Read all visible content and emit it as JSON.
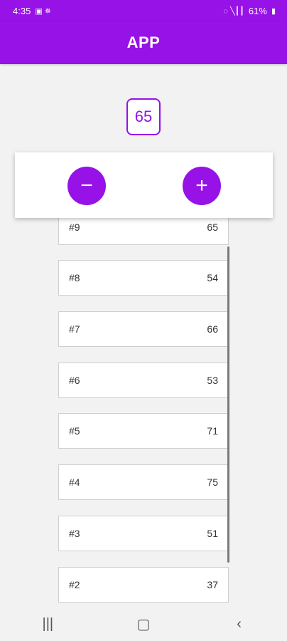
{
  "status_bar": {
    "time": "4:35",
    "battery": "61%",
    "left_icons": "▣ ✵",
    "right_icons": "◌ ╲┃┃"
  },
  "app_bar": {
    "title": "APP",
    "color": "#9612e6"
  },
  "counter": {
    "value": "65"
  },
  "controls": {
    "minus_label": "−",
    "plus_label": "+"
  },
  "list": {
    "items": [
      {
        "label": "#9",
        "value": "65"
      },
      {
        "label": "#8",
        "value": "54"
      },
      {
        "label": "#7",
        "value": "66"
      },
      {
        "label": "#6",
        "value": "53"
      },
      {
        "label": "#5",
        "value": "71"
      },
      {
        "label": "#4",
        "value": "75"
      },
      {
        "label": "#3",
        "value": "51"
      },
      {
        "label": "#2",
        "value": "37"
      }
    ]
  },
  "nav_bar": {
    "recents_icon": "|||",
    "home_icon": "▢",
    "back_icon": "‹"
  }
}
